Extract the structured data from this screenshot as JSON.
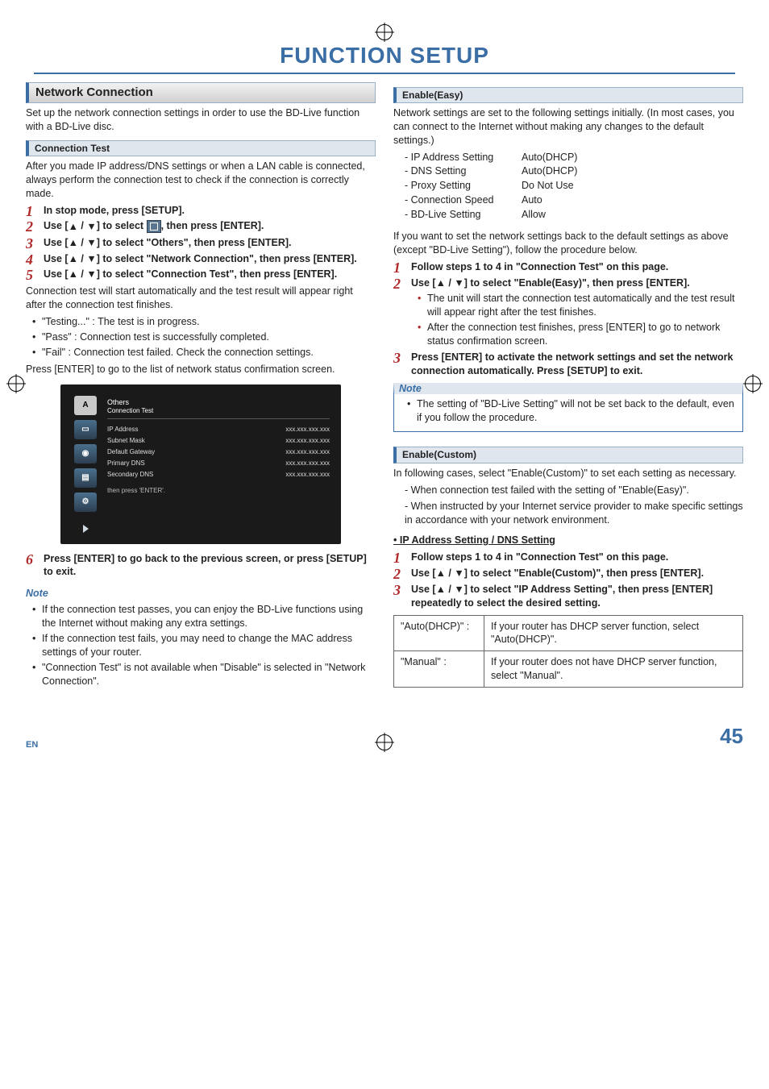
{
  "header": {
    "title": "FUNCTION SETUP"
  },
  "left": {
    "section": "Network Connection",
    "intro": "Set up the network connection settings in order to use the BD-Live function with a BD-Live disc.",
    "connTest": {
      "bar": "Connection Test",
      "p": "After you made IP address/DNS settings or when a LAN cable is connected, always perform the connection test to check if the connection is correctly made.",
      "steps": [
        "In stop mode, press [SETUP].",
        "Use [▲ / ▼] to select ⬚, then press [ENTER].",
        "Use [▲ / ▼] to select \"Others\", then press [ENTER].",
        "Use [▲ / ▼] to select \"Network Connection\", then press [ENTER].",
        "Use [▲ / ▼] to select \"Connection Test\", then press [ENTER]."
      ],
      "after": "Connection test will start automatically and the test result will appear right after the connection test finishes.",
      "results": [
        "\"Testing...\" : The test is in progress.",
        "\"Pass\" : Connection test is successfully completed.",
        "\"Fail\" : Connection test failed. Check the connection settings."
      ],
      "press": "Press [ENTER] to go to the list of network status confirmation screen.",
      "step6": "Press [ENTER] to go back to the previous screen, or press [SETUP] to exit.",
      "note": {
        "title": "Note",
        "items": [
          "If the connection test passes, you can enjoy the BD-Live functions using the Internet without making any extra settings.",
          "If the connection test fails, you may need to change the MAC address settings of your router.",
          "\"Connection Test\" is not available when \"Disable\" is selected in \"Network Connection\"."
        ]
      },
      "ss": {
        "iconA": "A",
        "title": "Others",
        "sub": "Connection Test",
        "rows": [
          {
            "k": "IP Address",
            "v": "xxx.xxx.xxx.xxx"
          },
          {
            "k": "Subnet Mask",
            "v": "xxx.xxx.xxx.xxx"
          },
          {
            "k": "Default Gateway",
            "v": "xxx.xxx.xxx.xxx"
          },
          {
            "k": "Primary DNS",
            "v": "xxx.xxx.xxx.xxx"
          },
          {
            "k": "Secondary DNS",
            "v": "xxx.xxx.xxx.xxx"
          }
        ],
        "foot": "then press 'ENTER'."
      }
    }
  },
  "right": {
    "easy": {
      "bar": "Enable(Easy)",
      "intro": "Network settings are set to the following settings initially. (In most cases, you can connect to the Internet without making any changes to the default settings.)",
      "rows": [
        {
          "k": "- IP Address Setting",
          "v": "Auto(DHCP)"
        },
        {
          "k": "- DNS Setting",
          "v": "Auto(DHCP)"
        },
        {
          "k": "- Proxy Setting",
          "v": "Do Not Use"
        },
        {
          "k": "- Connection Speed",
          "v": "Auto"
        },
        {
          "k": "- BD-Live Setting",
          "v": "Allow"
        }
      ],
      "p2": "If you want to set the network settings back to the default settings as above (except \"BD-Live Setting\"), follow the procedure below.",
      "steps": [
        "Follow steps 1 to 4 in \"Connection Test\" on this page.",
        "Use [▲ / ▼] to select \"Enable(Easy)\", then press [ENTER].",
        "Press [ENTER] to activate the network settings and set the network connection automatically. Press [SETUP] to exit."
      ],
      "sub2": [
        "The unit will start the connection test automatically and the test result will appear right after the test finishes.",
        "After the connection test finishes, press [ENTER] to go to network status confirmation screen."
      ],
      "note": {
        "title": "Note",
        "item": "The setting of \"BD-Live Setting\" will not be set back to the default, even if you follow the procedure."
      }
    },
    "custom": {
      "bar": "Enable(Custom)",
      "intro": "In following cases, select \"Enable(Custom)\" to set each setting as necessary.",
      "cases": [
        "When connection test failed with the setting of \"Enable(Easy)\".",
        "When instructed by your Internet service provider to make specific settings in accordance with your network environment."
      ],
      "sub": "• IP Address Setting / DNS Setting",
      "steps": [
        "Follow steps 1 to 4 in \"Connection Test\" on this page.",
        "Use [▲ / ▼] to select \"Enable(Custom)\", then press [ENTER].",
        "Use [▲ / ▼] to select \"IP Address Setting\", then press [ENTER] repeatedly to select the desired setting."
      ],
      "table": [
        {
          "k": "\"Auto(DHCP)\" :",
          "v": "If your router has DHCP server function, select \"Auto(DHCP)\"."
        },
        {
          "k": "\"Manual\" :",
          "v": "If your router does not have DHCP server function, select \"Manual\"."
        }
      ]
    }
  },
  "footer": {
    "en": "EN",
    "page": "45"
  }
}
